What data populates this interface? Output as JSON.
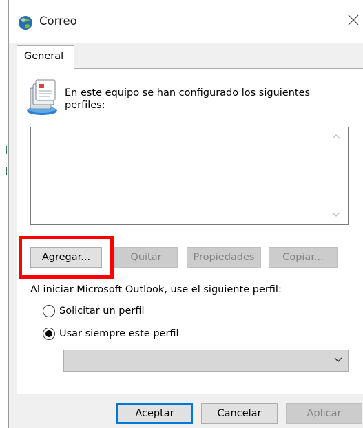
{
  "window": {
    "title": "Correo",
    "icon": "outlook-mail-globe-icon",
    "close_icon": "close-icon"
  },
  "tabs": [
    {
      "label": "General",
      "selected": true
    }
  ],
  "profiles": {
    "icon": "mail-profiles-icon",
    "info_text": "En este equipo se han configurado los siguientes perfiles:",
    "items": []
  },
  "actions": {
    "add_label": "Agregar...",
    "remove_label": "Quitar",
    "properties_label": "Propiedades",
    "copy_label": "Copiar..."
  },
  "startup": {
    "label": "Al iniciar Microsoft Outlook, use el siguiente perfil:",
    "options": [
      {
        "label": "Solicitar un perfil",
        "selected": false
      },
      {
        "label": "Usar siempre este perfil",
        "selected": true
      }
    ],
    "profile_select_value": ""
  },
  "footer": {
    "ok_label": "Aceptar",
    "cancel_label": "Cancelar",
    "apply_label": "Aplicar"
  },
  "colors": {
    "highlight": "#ff0000",
    "dialog_bg": "#f0f0f0",
    "disabled_text": "#838383"
  }
}
